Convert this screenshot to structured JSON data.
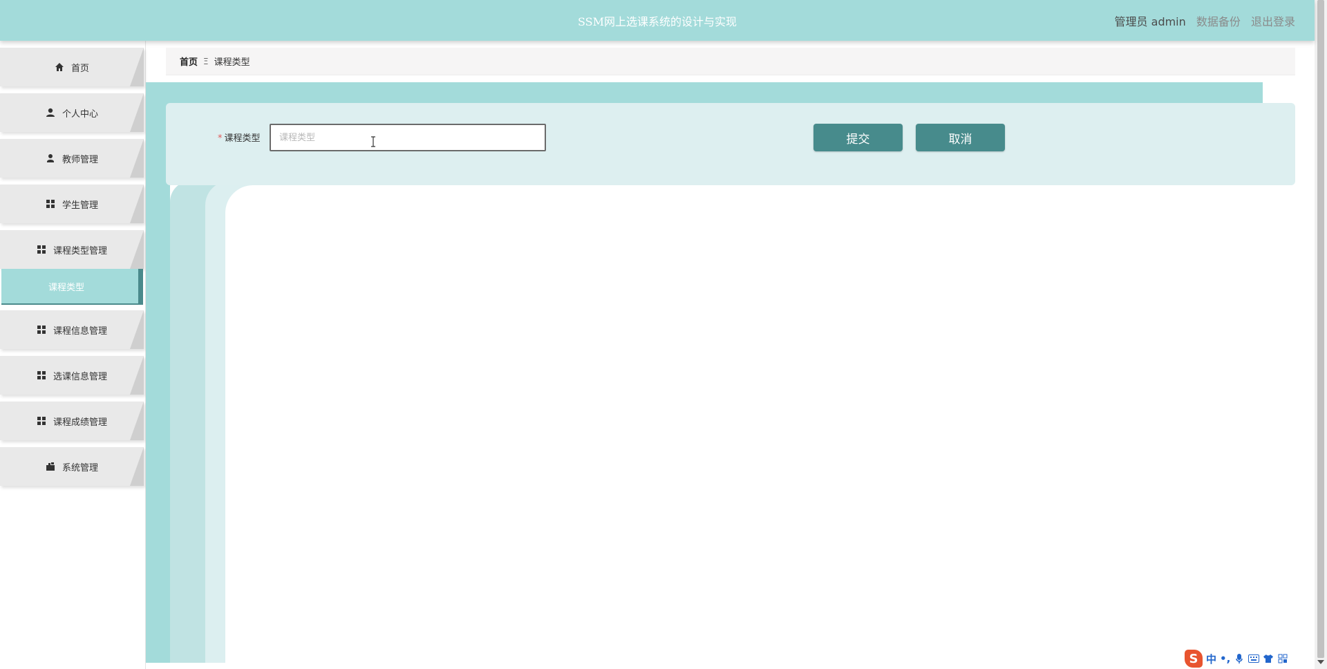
{
  "header": {
    "title": "SSM网上选课系统的设计与实现",
    "user_label": "管理员 admin",
    "backup_link": "数据备份",
    "logout_link": "退出登录"
  },
  "sidebar": {
    "items": [
      {
        "label": "首页",
        "icon": "home-icon"
      },
      {
        "label": "个人中心",
        "icon": "user-icon"
      },
      {
        "label": "教师管理",
        "icon": "teacher-icon"
      },
      {
        "label": "学生管理",
        "icon": "grid-icon"
      },
      {
        "label": "课程类型管理",
        "icon": "grid-icon"
      },
      {
        "label": "课程信息管理",
        "icon": "grid-icon"
      },
      {
        "label": "选课信息管理",
        "icon": "grid-icon"
      },
      {
        "label": "课程成绩管理",
        "icon": "grid-icon"
      },
      {
        "label": "系统管理",
        "icon": "settings-icon"
      }
    ],
    "active_sub_item": "课程类型"
  },
  "breadcrumb": {
    "home": "首页",
    "separator": "Ξ",
    "current": "课程类型"
  },
  "form": {
    "required_mark": "*",
    "field_label": "课程类型",
    "field_value": "",
    "field_placeholder": "课程类型",
    "submit_label": "提交",
    "cancel_label": "取消"
  },
  "ime": {
    "logo": "S",
    "mode": "中",
    "punct": "•,"
  },
  "colors": {
    "header_bg": "#a3dbda",
    "primary_button": "#478b8c",
    "active_menu": "#a3dbda",
    "form_panel": "#ddeff0"
  }
}
